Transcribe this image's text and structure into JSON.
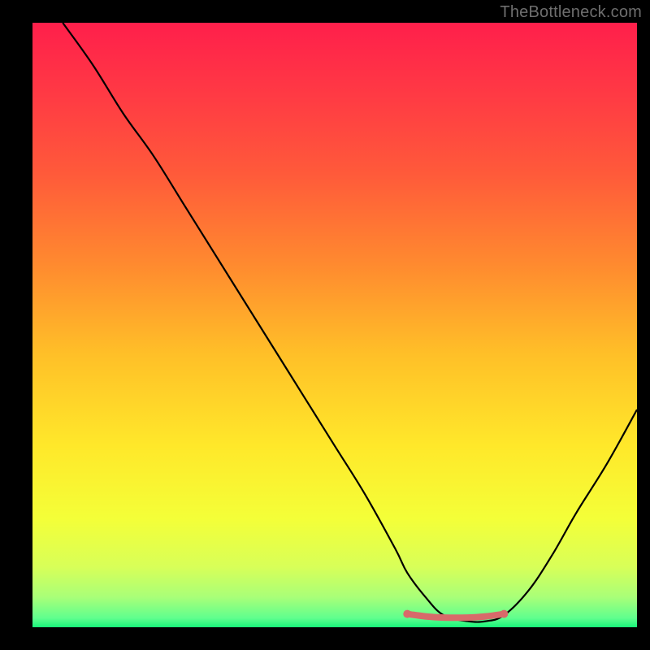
{
  "watermark": "TheBottleneck.com",
  "chart_data": {
    "type": "line",
    "title": "",
    "xlabel": "",
    "ylabel": "",
    "xlim": [
      0,
      100
    ],
    "ylim": [
      0,
      100
    ],
    "series": [
      {
        "name": "curve",
        "x": [
          5,
          10,
          15,
          20,
          25,
          30,
          35,
          40,
          45,
          50,
          55,
          60,
          62,
          65,
          68,
          72,
          75,
          78,
          82,
          86,
          90,
          95,
          100
        ],
        "y": [
          100,
          93,
          85,
          78,
          70,
          62,
          54,
          46,
          38,
          30,
          22,
          13,
          9,
          5,
          2,
          1,
          1,
          2,
          6,
          12,
          19,
          27,
          36
        ]
      },
      {
        "name": "flat-highlight",
        "x": [
          62,
          65,
          68,
          72,
          75,
          78
        ],
        "y": [
          2.2,
          1.8,
          1.6,
          1.6,
          1.8,
          2.2
        ]
      }
    ],
    "gradient_stops": [
      {
        "offset": 0.0,
        "color": "#ff1f4b"
      },
      {
        "offset": 0.12,
        "color": "#ff3a44"
      },
      {
        "offset": 0.25,
        "color": "#ff5a3a"
      },
      {
        "offset": 0.4,
        "color": "#ff8a2f"
      },
      {
        "offset": 0.55,
        "color": "#ffc028"
      },
      {
        "offset": 0.7,
        "color": "#ffe82a"
      },
      {
        "offset": 0.82,
        "color": "#f4ff38"
      },
      {
        "offset": 0.9,
        "color": "#d8ff58"
      },
      {
        "offset": 0.95,
        "color": "#a9ff78"
      },
      {
        "offset": 0.985,
        "color": "#5fff8e"
      },
      {
        "offset": 1.0,
        "color": "#18f57a"
      }
    ],
    "colors": {
      "curve": "#000000",
      "highlight": "#d86a6a"
    }
  }
}
